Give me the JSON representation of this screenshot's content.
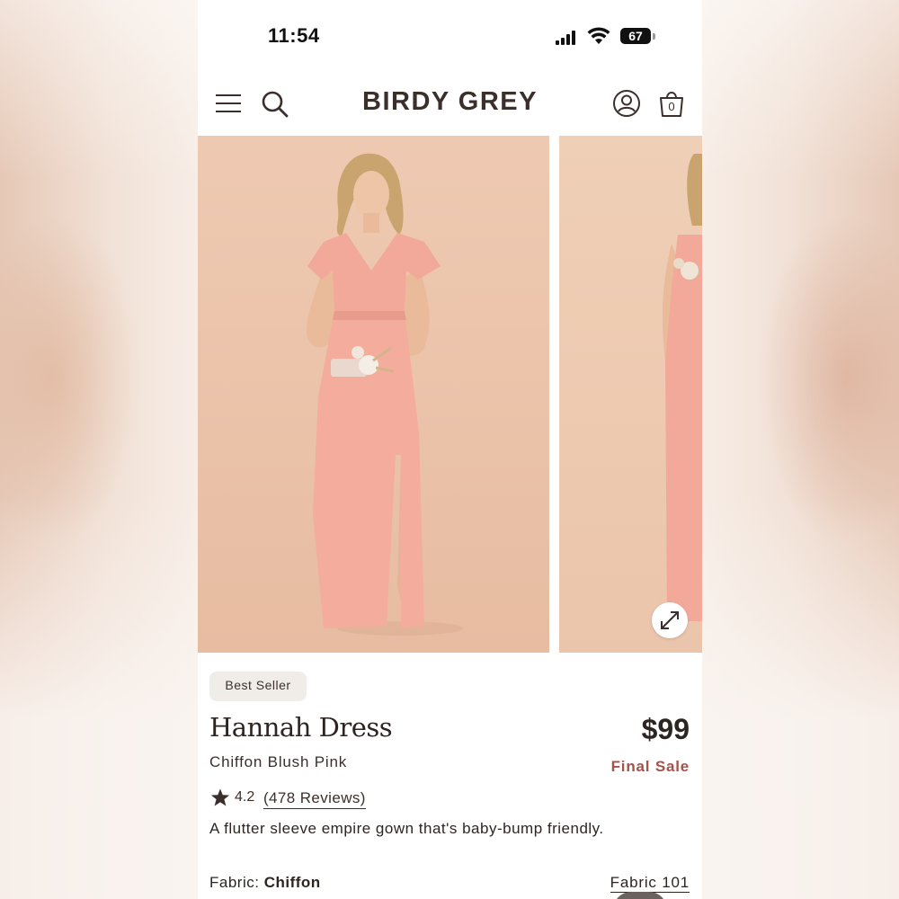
{
  "status_bar": {
    "time": "11:54",
    "battery": "67"
  },
  "header": {
    "brand": "BIRDY GREY",
    "cart_count": "0"
  },
  "product": {
    "badge": "Best Seller",
    "title": "Hannah Dress",
    "variant": "Chiffon Blush Pink",
    "price": "$99",
    "sale_label": "Final Sale",
    "rating": "4.2",
    "reviews_link": "(478 Reviews)",
    "description": "A flutter sleeve empire gown that's baby-bump friendly.",
    "fabric_label": "Fabric:",
    "fabric_value": "Chiffon",
    "fabric_link": "Fabric 101"
  },
  "colors": {
    "brand_text": "#3b2f2c",
    "final_sale": "#a6514a",
    "photo_bg": "#ecc6ad",
    "dress": "#f2a99a"
  },
  "icons": [
    "menu-icon",
    "search-icon",
    "account-icon",
    "cart-icon",
    "expand-icon",
    "star-icon"
  ]
}
